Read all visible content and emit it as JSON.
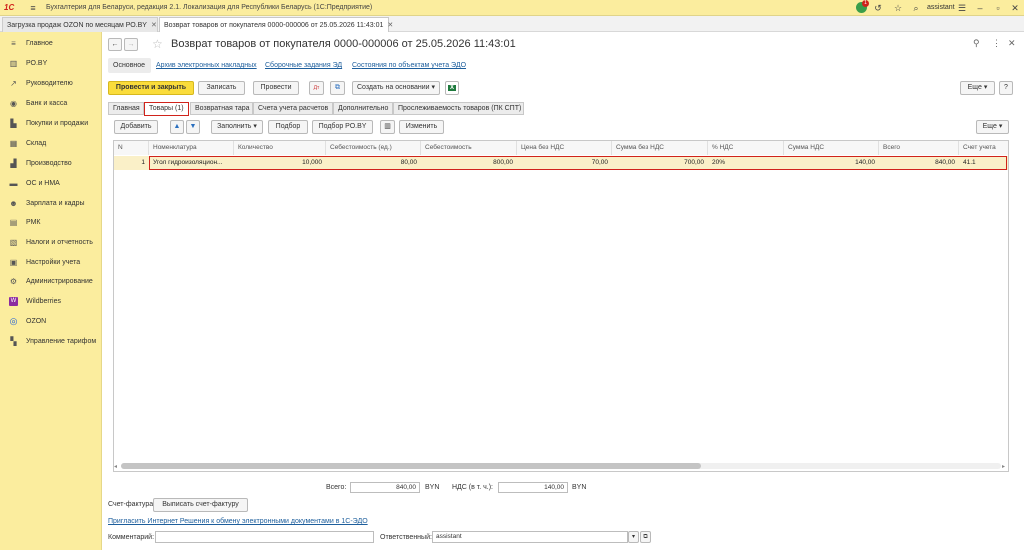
{
  "app": {
    "title": "Бухгалтерия для Беларуси, редакция 2.1. Локализация для Республики Беларусь   (1С:Предприятие)",
    "user": "assistant",
    "notification_count": "1",
    "logo": "1С"
  },
  "tabs": [
    {
      "label": "Загрузка продаж OZON по месяцам РО.BY"
    },
    {
      "label": "Возврат товаров от покупателя 0000-000006 от 25.05.2026 11:43:01"
    }
  ],
  "sidebar": {
    "items": [
      {
        "label": "Главное",
        "icon": "menu-icon"
      },
      {
        "label": "РО.BY",
        "icon": "chart-icon"
      },
      {
        "label": "Руководителю",
        "icon": "trend-icon"
      },
      {
        "label": "Банк и касса",
        "icon": "bank-icon"
      },
      {
        "label": "Покупки и продажи",
        "icon": "cart-icon"
      },
      {
        "label": "Склад",
        "icon": "warehouse-icon"
      },
      {
        "label": "Производство",
        "icon": "factory-icon"
      },
      {
        "label": "ОС и НМА",
        "icon": "truck-icon"
      },
      {
        "label": "Зарплата и кадры",
        "icon": "people-icon"
      },
      {
        "label": "РМК",
        "icon": "register-icon"
      },
      {
        "label": "Налоги и отчетность",
        "icon": "report-icon"
      },
      {
        "label": "Настройки учета",
        "icon": "settings-doc-icon"
      },
      {
        "label": "Администрирование",
        "icon": "gear-icon"
      },
      {
        "label": "Wildberries",
        "icon": "wildberries-icon"
      },
      {
        "label": "OZON",
        "icon": "ozon-icon"
      },
      {
        "label": "Управление тарифом",
        "icon": "tariff-icon"
      }
    ]
  },
  "doc": {
    "title": "Возврат товаров от покупателя 0000-000006 от 25.05.2026 11:43:01",
    "links": [
      "Основное",
      "Архив электронных накладных",
      "Сборочные задания ЭД",
      "Состояния по объектам учета ЭДО"
    ],
    "toolbar": {
      "post_close": "Провести и закрыть",
      "save": "Записать",
      "post": "Провести",
      "create_based": "Создать на основании",
      "more": "Еще",
      "help": "?"
    },
    "form_tabs": [
      "Главная",
      "Товары (1)",
      "Возвратная тара",
      "Счета учета расчетов",
      "Дополнительно",
      "Прослеживаемость товаров (ПК СПТ)"
    ],
    "grid_toolbar": {
      "add": "Добавить",
      "fill": "Заполнить",
      "selection": "Подбор",
      "selection_ro": "Подбор РО.BY",
      "change": "Изменить",
      "more": "Еще"
    },
    "columns": [
      "N",
      "Номенклатура",
      "Количество",
      "Себестоимость (ед.)",
      "Себестоимость",
      "Цена без НДС",
      "Сумма без НДС",
      "% НДС",
      "Сумма НДС",
      "Всего",
      "Счет учета"
    ],
    "rows": [
      {
        "n": "1",
        "item": "Угол гидроизоляцион...",
        "qty": "10,000",
        "cost_unit": "80,00",
        "cost": "800,00",
        "price": "70,00",
        "sum": "700,00",
        "vat_rate": "20%",
        "vat_sum": "140,00",
        "total": "840,00",
        "account": "41.1"
      }
    ],
    "totals": {
      "total_label": "Всего:",
      "total_value": "840,00",
      "currency": "BYN",
      "vat_label": "НДС (в т. ч.):",
      "vat_value": "140,00"
    },
    "invoice": {
      "label": "Счет-фактура:",
      "button": "Выписать счет-фактуру"
    },
    "edo_link": "Пригласить Интернет Решения к обмену электронными документами в 1С-ЭДО",
    "comment_label": "Комментарий:",
    "comment_value": "",
    "responsible_label": "Ответственный:",
    "responsible_value": "assistant"
  }
}
